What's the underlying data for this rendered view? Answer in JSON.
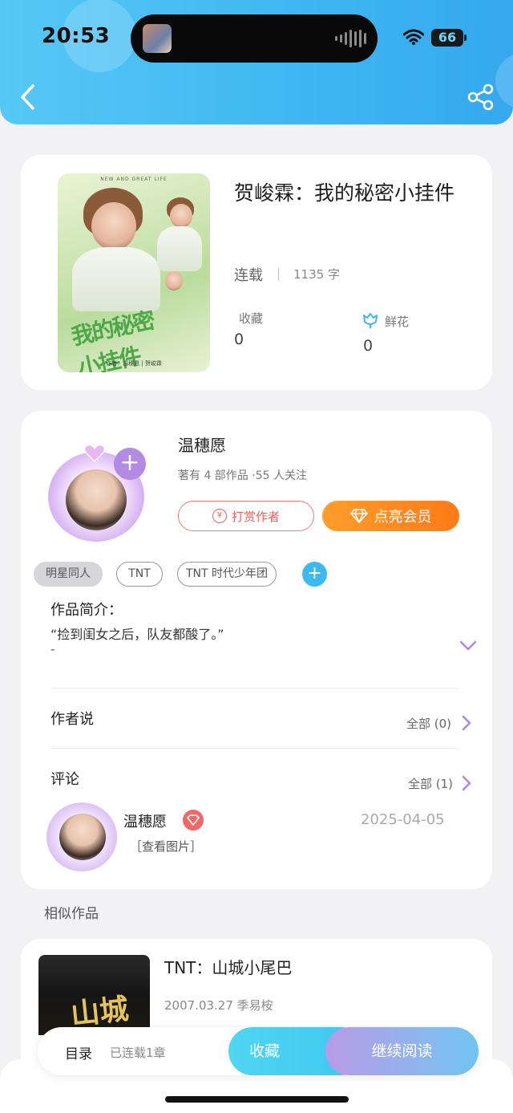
{
  "status_bar": {
    "time": "20:53",
    "battery": "66"
  },
  "book": {
    "title": "贺峻霖：我的秘密小挂件",
    "status": "连载",
    "word_count": "1135 字",
    "collect_label": "收藏",
    "collect_count": "0",
    "flower_label": "鲜花",
    "flower_count": "0",
    "cover_top_text": "NEW AND GREAT LIFE",
    "cover_title_art": "我的秘密小挂件",
    "cover_bottom_text": "作者：温穗愿 | 贺峻霖"
  },
  "author": {
    "name": "温穗愿",
    "meta": "著有 4 部作品 ·55 人关注",
    "tip_label": "打赏作者",
    "tip_icon_text": "¥",
    "vip_label": "点亮会员",
    "follow_glyph": "+"
  },
  "tags": [
    "明星同人",
    "TNT",
    "TNT 时代少年团"
  ],
  "tag_add_glyph": "+",
  "intro": {
    "title": "作品简介：",
    "text": "“捡到闺女之后，队友都酸了。”",
    "dash": "-"
  },
  "author_says": {
    "title": "作者说",
    "more": "全部 (0)"
  },
  "comments": {
    "title": "评论",
    "more": "全部 (1)",
    "items": [
      {
        "name": "温穗愿",
        "date": "2025-04-05",
        "text": "［查看图片］"
      }
    ]
  },
  "similar": {
    "label": "相似作品",
    "items": [
      {
        "title": "TNT：山城小尾巴",
        "sub": "2007.03.27 季易桉",
        "cover_text": "山城"
      }
    ]
  },
  "bottom_bar": {
    "toc_label": "目录",
    "chapters": "已连载1章",
    "favorite_label": "收藏",
    "continue_label": "继续阅读"
  },
  "colors": {
    "header": "#3fb6f2",
    "vip": "#ff8a1e",
    "tip": "#e46462",
    "accent_purple": "#b38ae4"
  }
}
